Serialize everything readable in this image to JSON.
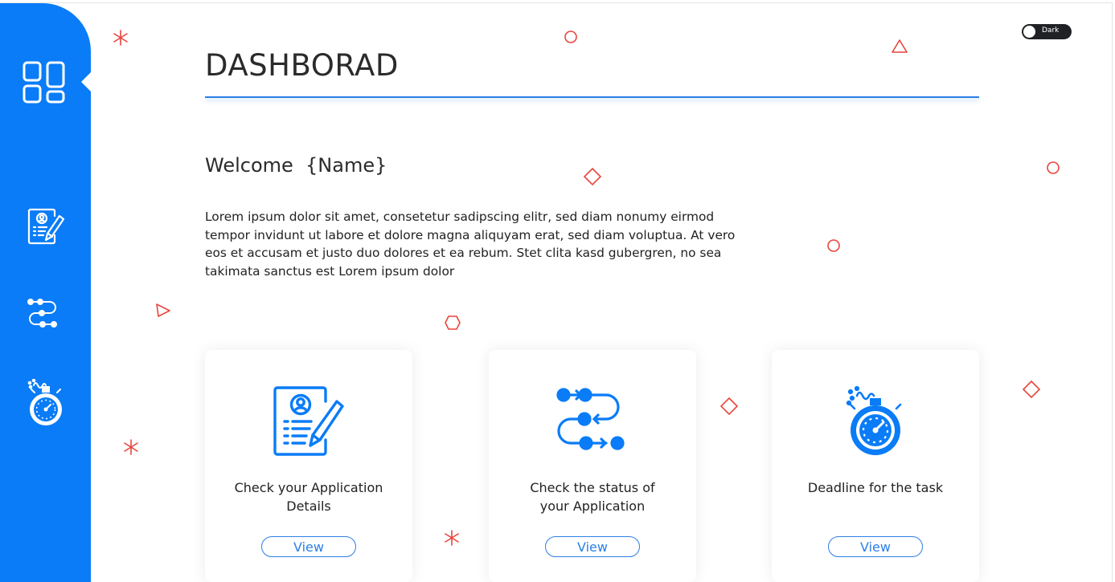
{
  "header": {
    "title": "DASHBORAD",
    "theme_toggle_label": "Dark"
  },
  "welcome": {
    "heading": "Welcome  {Name}",
    "paragraph": "Lorem ipsum dolor sit amet, consetetur sadipscing elitr, sed diam nonumy eirmod tempor invidunt ut labore et dolore magna aliquyam erat, sed diam voluptua. At vero eos et accusam et justo duo dolores et ea rebum. Stet clita kasd gubergren, no sea takimata sanctus est Lorem ipsum dolor"
  },
  "sidebar": {
    "items": [
      {
        "icon": "dashboard-grid-icon"
      },
      {
        "icon": "application-document-icon"
      },
      {
        "icon": "status-flow-icon"
      },
      {
        "icon": "stopwatch-icon"
      }
    ]
  },
  "cards": [
    {
      "icon": "application-document-icon",
      "line1": "Check your Application",
      "line2": "Details",
      "button": "View"
    },
    {
      "icon": "status-flow-icon",
      "line1": "Check the status of",
      "line2": "your Application",
      "button": "View"
    },
    {
      "icon": "stopwatch-icon",
      "line1": "Deadline for the task",
      "line2": "",
      "button": "View"
    }
  ],
  "colors": {
    "primary": "#0a7cf7",
    "accent_blue": "#2c7fe6",
    "decoration": "#e8453c",
    "text": "#2b2b2b",
    "toggle_bg": "#202124"
  }
}
